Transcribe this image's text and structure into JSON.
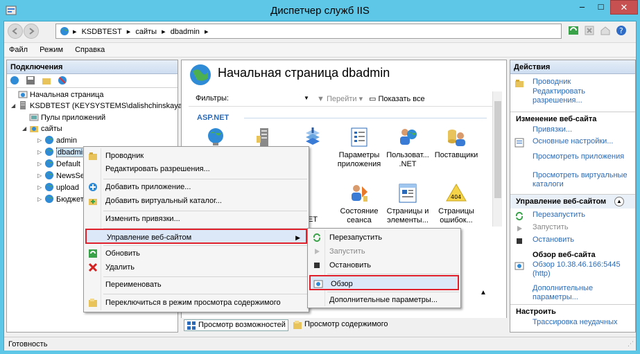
{
  "window": {
    "title": "Диспетчер служб IIS",
    "close_glyph": "✕",
    "min_glyph": "–",
    "max_glyph": "□"
  },
  "address": {
    "crumbs": [
      "KSDBTEST",
      "сайты",
      "dbadmin"
    ],
    "sep": "▸"
  },
  "menu": [
    "Файл",
    "Режим",
    "Справка"
  ],
  "connections": {
    "header": "Подключения",
    "tree": [
      {
        "label": "Начальная страница",
        "icon": "home-page-icon",
        "level": 0,
        "exp": ""
      },
      {
        "label": "KSDBTEST (KEYSYSTEMS\\dalishchinskaya)",
        "icon": "server-icon",
        "level": 0,
        "exp": "◢"
      },
      {
        "label": "Пулы приложений",
        "icon": "app-pool-icon",
        "level": 1,
        "exp": ""
      },
      {
        "label": "сайты",
        "icon": "sites-folder-icon",
        "level": 1,
        "exp": "◢"
      },
      {
        "label": "admin",
        "icon": "globe-icon",
        "level": 2,
        "exp": "▷"
      },
      {
        "label": "dbadmin",
        "icon": "globe-icon",
        "level": 2,
        "exp": "▷",
        "selected": true
      },
      {
        "label": "Default",
        "icon": "globe-icon",
        "level": 2,
        "exp": "▷"
      },
      {
        "label": "NewsSe",
        "icon": "globe-icon",
        "level": 2,
        "exp": "▷"
      },
      {
        "label": "upload",
        "icon": "globe-icon",
        "level": 2,
        "exp": "▷"
      },
      {
        "label": "Бюджет",
        "icon": "globe-icon",
        "level": 2,
        "exp": "▷"
      }
    ]
  },
  "center": {
    "title": "Начальная страница dbadmin",
    "filters_label": "Фильтры:",
    "go_label": "Перейти",
    "show_all_label": "Показать все",
    "group_label": "ASP.NET",
    "features": [
      {
        "label": "",
        "icon": "globe-net-icon"
      },
      {
        "label": "",
        "icon": "server-rack-icon"
      },
      {
        "label": "ляция\nT",
        "icon": "compilation-icon"
      },
      {
        "label": "Параметры\nприложения",
        "icon": "app-settings-icon"
      },
      {
        "label": "Пользоват...\n.NET",
        "icon": "net-users-icon"
      },
      {
        "label": "Поставщики",
        "icon": "providers-icon"
      },
      {
        "label": "NET",
        "icon": "net-icon"
      },
      {
        "label": "Состояние\nсеанса",
        "icon": "session-state-icon"
      },
      {
        "label": "Страницы и\nэлементы...",
        "icon": "pages-controls-icon"
      },
      {
        "label": "Страницы\nошибок...",
        "icon": "error-pages-icon"
      }
    ],
    "error_badge": "404",
    "view_tabs": [
      "Просмотр возможностей",
      "Просмотр содержимого"
    ]
  },
  "actions": {
    "header": "Действия",
    "top": [
      {
        "label": "Проводник",
        "icon": "explorer-icon"
      },
      {
        "label": "Редактировать разрешения...",
        "icon": ""
      }
    ],
    "edit_site_header": "Изменение веб-сайта",
    "edit_site": [
      {
        "label": "Привязки...",
        "icon": ""
      },
      {
        "label": "Основные настройки...",
        "icon": "basic-settings-icon"
      },
      {
        "label": "Просмотреть приложения",
        "icon": ""
      },
      {
        "label": "Просмотреть виртуальные каталоги",
        "icon": ""
      }
    ],
    "manage_header": "Управление веб-сайтом",
    "manage": [
      {
        "label": "Перезапустить",
        "icon": "restart-icon",
        "state": "enabled"
      },
      {
        "label": "Запустить",
        "icon": "start-icon",
        "state": "disabled"
      },
      {
        "label": "Остановить",
        "icon": "stop-icon",
        "state": "enabled"
      }
    ],
    "browse_header": "Обзор веб-сайта",
    "browse_link": "Обзор 10.38.46.166:5445 (http)",
    "advanced_link": "Дополнительные параметры...",
    "configure_header": "Настроить",
    "configure_link": "Трассировка неудачных"
  },
  "status": "Готовность",
  "context_menu": {
    "items": [
      {
        "label": "Проводник",
        "icon": "explorer-icon"
      },
      {
        "label": "Редактировать разрешения...",
        "icon": ""
      },
      {
        "label": "Добавить приложение...",
        "icon": "add-app-icon"
      },
      {
        "label": "Добавить виртуальный каталог...",
        "icon": "add-vdir-icon"
      },
      {
        "label": "Изменить привязки...",
        "icon": ""
      },
      {
        "label": "Управление веб-сайтом",
        "icon": ""
      },
      {
        "label": "Обновить",
        "icon": "refresh-icon"
      },
      {
        "label": "Удалить",
        "icon": "delete-icon"
      },
      {
        "label": "Переименовать",
        "icon": ""
      },
      {
        "label": "Переключиться в режим просмотра содержимого",
        "icon": "content-view-icon"
      }
    ],
    "submenu": [
      {
        "label": "Перезапустить",
        "icon": "restart-icon"
      },
      {
        "label": "Запустить",
        "icon": "start-icon"
      },
      {
        "label": "Остановить",
        "icon": "stop-icon"
      },
      {
        "label": "Обзор",
        "icon": "browse-icon"
      },
      {
        "label": "Дополнительные параметры...",
        "icon": ""
      }
    ]
  },
  "colors": {
    "chrome": "#5ec6e6",
    "highlight_border": "#e0202a",
    "link": "#2a6ab8"
  }
}
